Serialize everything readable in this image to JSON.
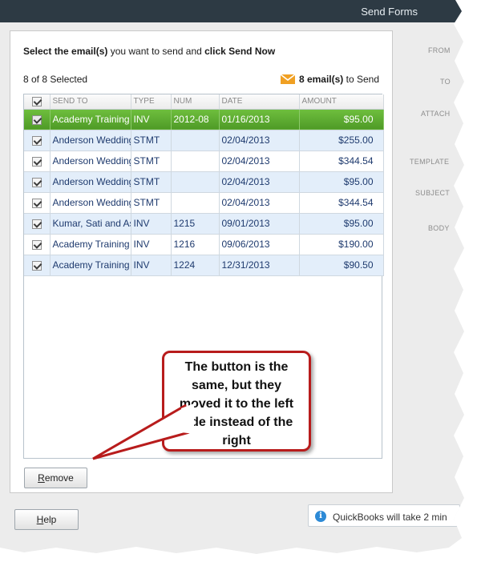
{
  "window": {
    "title": "Send Forms"
  },
  "instructions": {
    "part1": "Select the email(s)",
    "part2": " you want to send and ",
    "part3": "click Send Now"
  },
  "selection": {
    "count_text": "8 of 8 Selected"
  },
  "send_summary": {
    "count": "8 email(s)",
    "suffix": " to Send",
    "icon": "envelope-icon",
    "icon_color": "#f0a023"
  },
  "table": {
    "columns": [
      "SEND TO",
      "TYPE",
      "NUM",
      "DATE",
      "AMOUNT"
    ],
    "rows": [
      {
        "send_to": "Academy Training Center",
        "type": "INV",
        "num": "2012-08",
        "date": "01/16/2013",
        "amount": "$95.00",
        "checked": true
      },
      {
        "send_to": "Anderson Wedding",
        "type": "STMT",
        "num": "",
        "date": "02/04/2013",
        "amount": "$255.00",
        "checked": true
      },
      {
        "send_to": "Anderson Wedding",
        "type": "STMT",
        "num": "",
        "date": "02/04/2013",
        "amount": "$344.54",
        "checked": true
      },
      {
        "send_to": "Anderson Wedding",
        "type": "STMT",
        "num": "",
        "date": "02/04/2013",
        "amount": "$95.00",
        "checked": true
      },
      {
        "send_to": "Anderson Wedding",
        "type": "STMT",
        "num": "",
        "date": "02/04/2013",
        "amount": "$344.54",
        "checked": true
      },
      {
        "send_to": "Kumar, Sati and Associates",
        "type": "INV",
        "num": "1215",
        "date": "09/01/2013",
        "amount": "$95.00",
        "checked": true
      },
      {
        "send_to": "Academy Training Center",
        "type": "INV",
        "num": "1216",
        "date": "09/06/2013",
        "amount": "$190.00",
        "checked": true
      },
      {
        "send_to": "Academy Training Center",
        "type": "INV",
        "num": "1224",
        "date": "12/31/2013",
        "amount": "$90.50",
        "checked": true
      }
    ]
  },
  "buttons": {
    "remove_first": "R",
    "remove_rest": "emove",
    "help_first": "H",
    "help_rest": "elp"
  },
  "right_labels": [
    "FROM",
    "TO",
    "ATTACH",
    "TEMPLATE",
    "SUBJECT",
    "BODY"
  ],
  "status": {
    "text": "QuickBooks will take 2 min"
  },
  "callout": {
    "text": "The button is the same, but they moved it to the left side instead of the right"
  },
  "colors": {
    "selected_row": "#5aa82e",
    "alt_row": "#e3eefa",
    "callout_border": "#b81c1c",
    "titlebar": "#2d3a44"
  }
}
